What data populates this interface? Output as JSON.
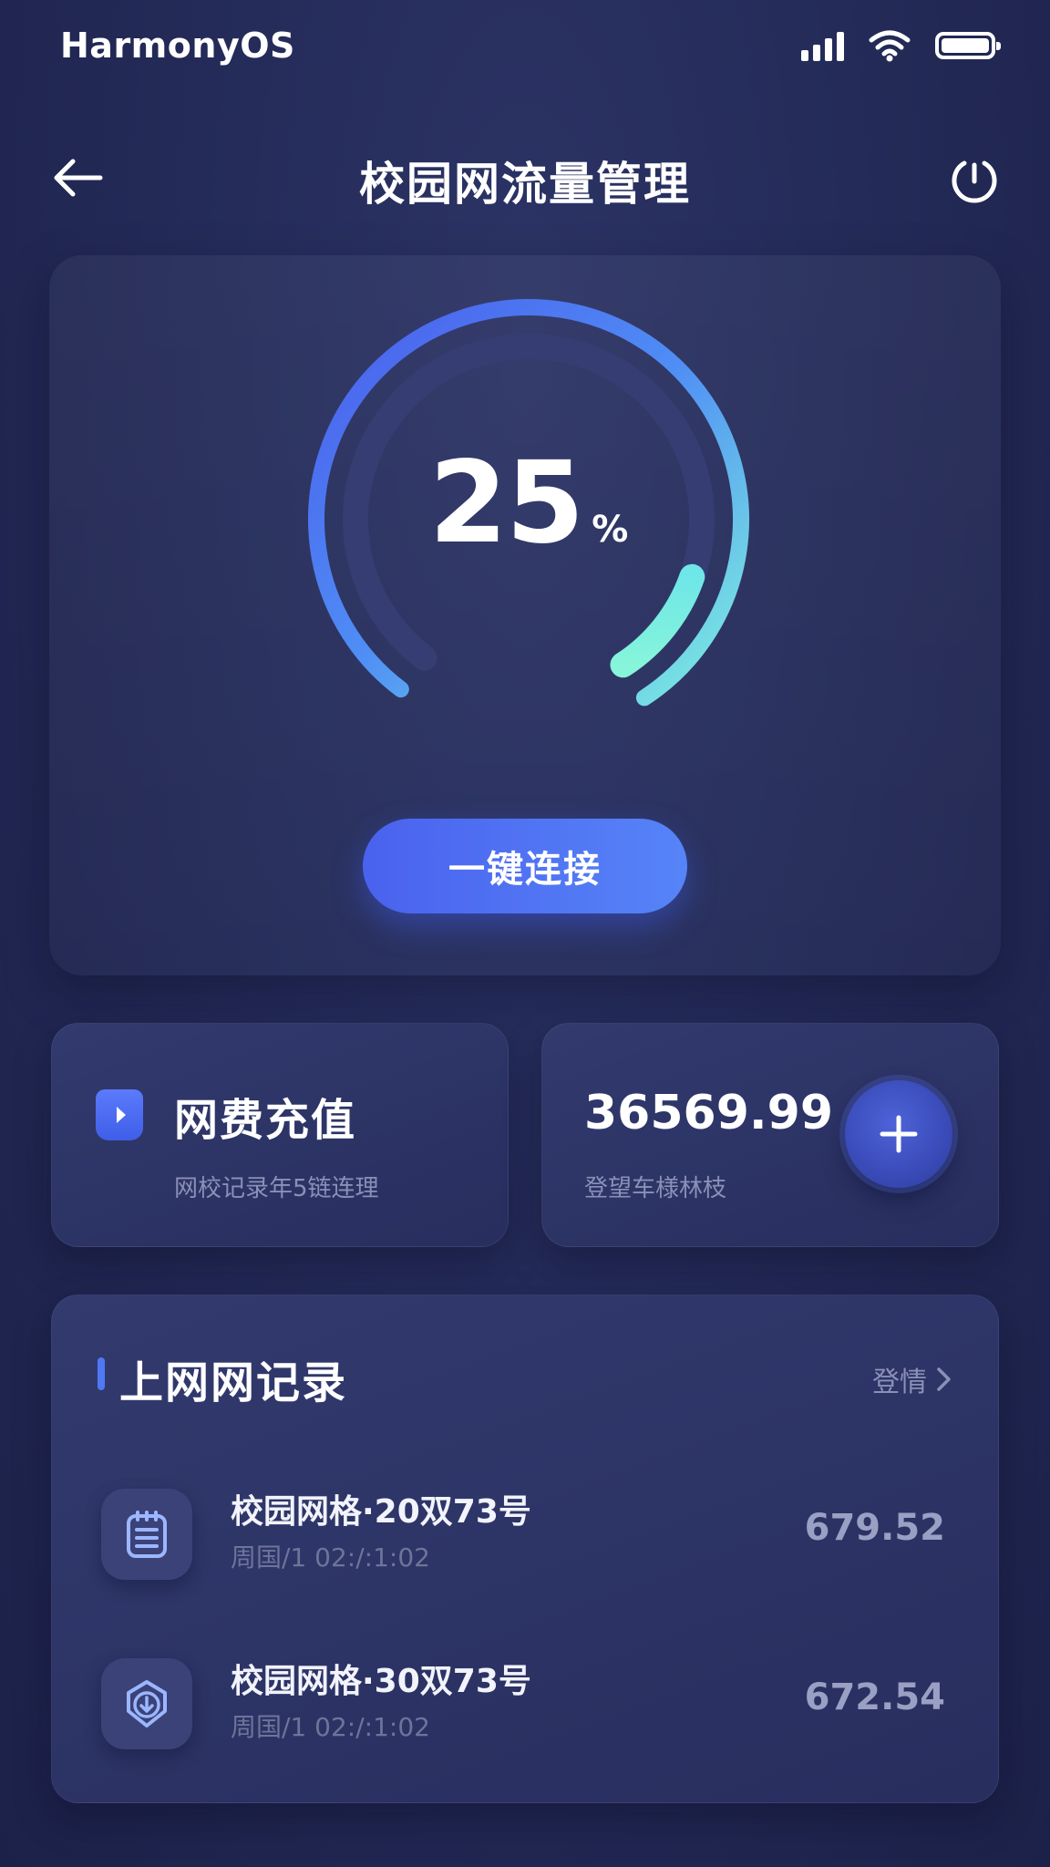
{
  "status_bar": {
    "os_name": "HarmonyOS"
  },
  "header": {
    "title": "校园网流量管理"
  },
  "gauge": {
    "value": "25",
    "unit": "%",
    "percent": 25
  },
  "connect_button": {
    "label": "一键连接"
  },
  "recharge": {
    "title": "网费充值",
    "subtitle": "网校记录年5链连理"
  },
  "balance": {
    "value": "36569.99",
    "subtitle": "登望车様林枝"
  },
  "records": {
    "title": "上网网记录",
    "more_label": "登情",
    "items": [
      {
        "name": "校园网格·20双73号",
        "time": "周国/1  02:/:1:02",
        "amount": "679.52",
        "icon": "notepad-icon"
      },
      {
        "name": "校园网格·30双73号",
        "time": "周国/1  02:/:1:02",
        "amount": "672.54",
        "icon": "download-shield-icon"
      }
    ]
  },
  "colors": {
    "accent_blue": "#4f6cf2",
    "gauge_start": "#4a5ff0",
    "gauge_end": "#7ff0e0",
    "background": "#242b58"
  }
}
